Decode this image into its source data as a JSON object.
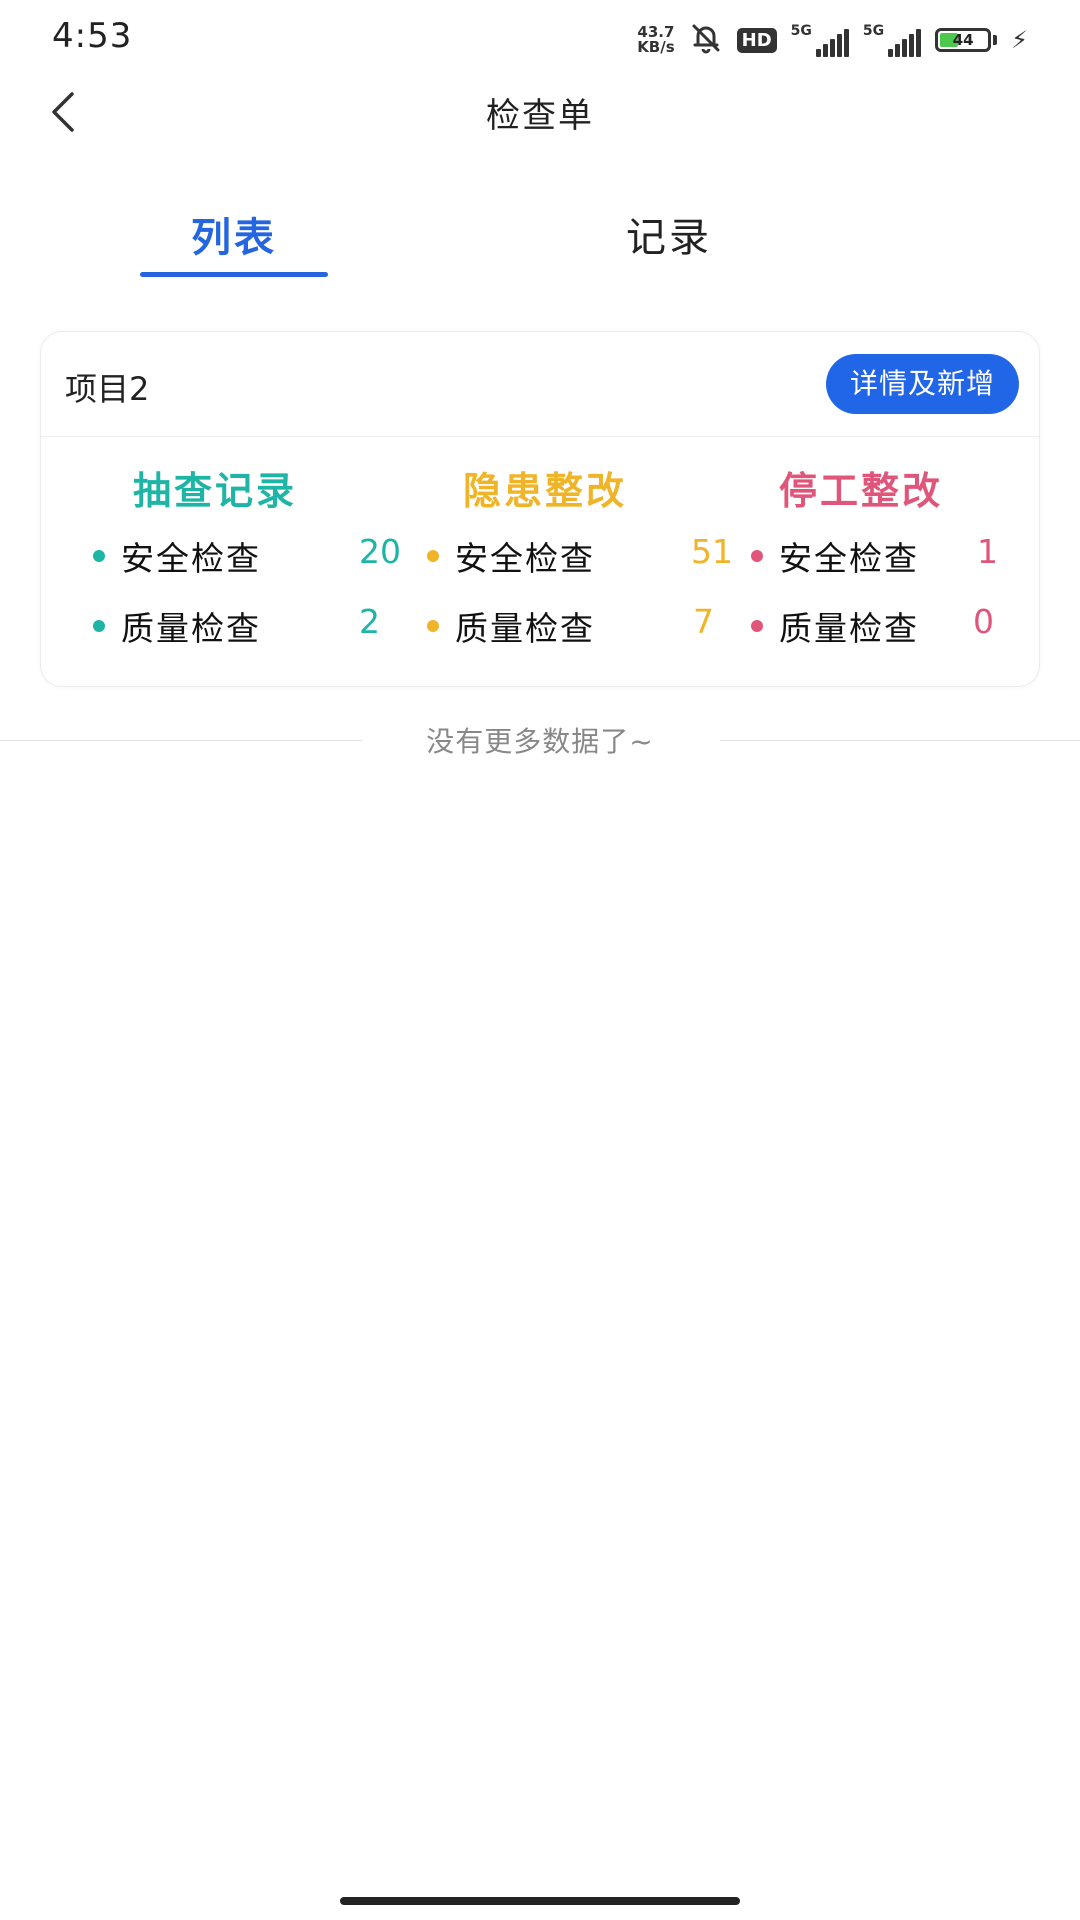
{
  "status_bar": {
    "time": "4:53",
    "net_speed_value": "43.7",
    "net_speed_unit": "KB/s",
    "hd_label": "HD",
    "signal_label": "5G",
    "battery_level": "44"
  },
  "nav": {
    "title": "检查单"
  },
  "tabs": {
    "list_label": "列表",
    "records_label": "记录"
  },
  "card": {
    "project_name": "项目2",
    "details_button_label": "详情及新增",
    "columns": [
      {
        "title": "抽查记录",
        "color": "#1fb5a6",
        "rows": [
          {
            "label": "安全检查",
            "value": "20"
          },
          {
            "label": "质量检查",
            "value": "2"
          }
        ]
      },
      {
        "title": "隐患整改",
        "color": "#f0b429",
        "rows": [
          {
            "label": "安全检查",
            "value": "51"
          },
          {
            "label": "质量检查",
            "value": "7"
          }
        ]
      },
      {
        "title": "停工整改",
        "color": "#e0567a",
        "rows": [
          {
            "label": "安全检查",
            "value": "1"
          },
          {
            "label": "质量检查",
            "value": "0"
          }
        ]
      }
    ]
  },
  "footer": {
    "no_more_text": "没有更多数据了~"
  },
  "colors": {
    "accent": "#2566e0",
    "button": "#2266e8"
  }
}
